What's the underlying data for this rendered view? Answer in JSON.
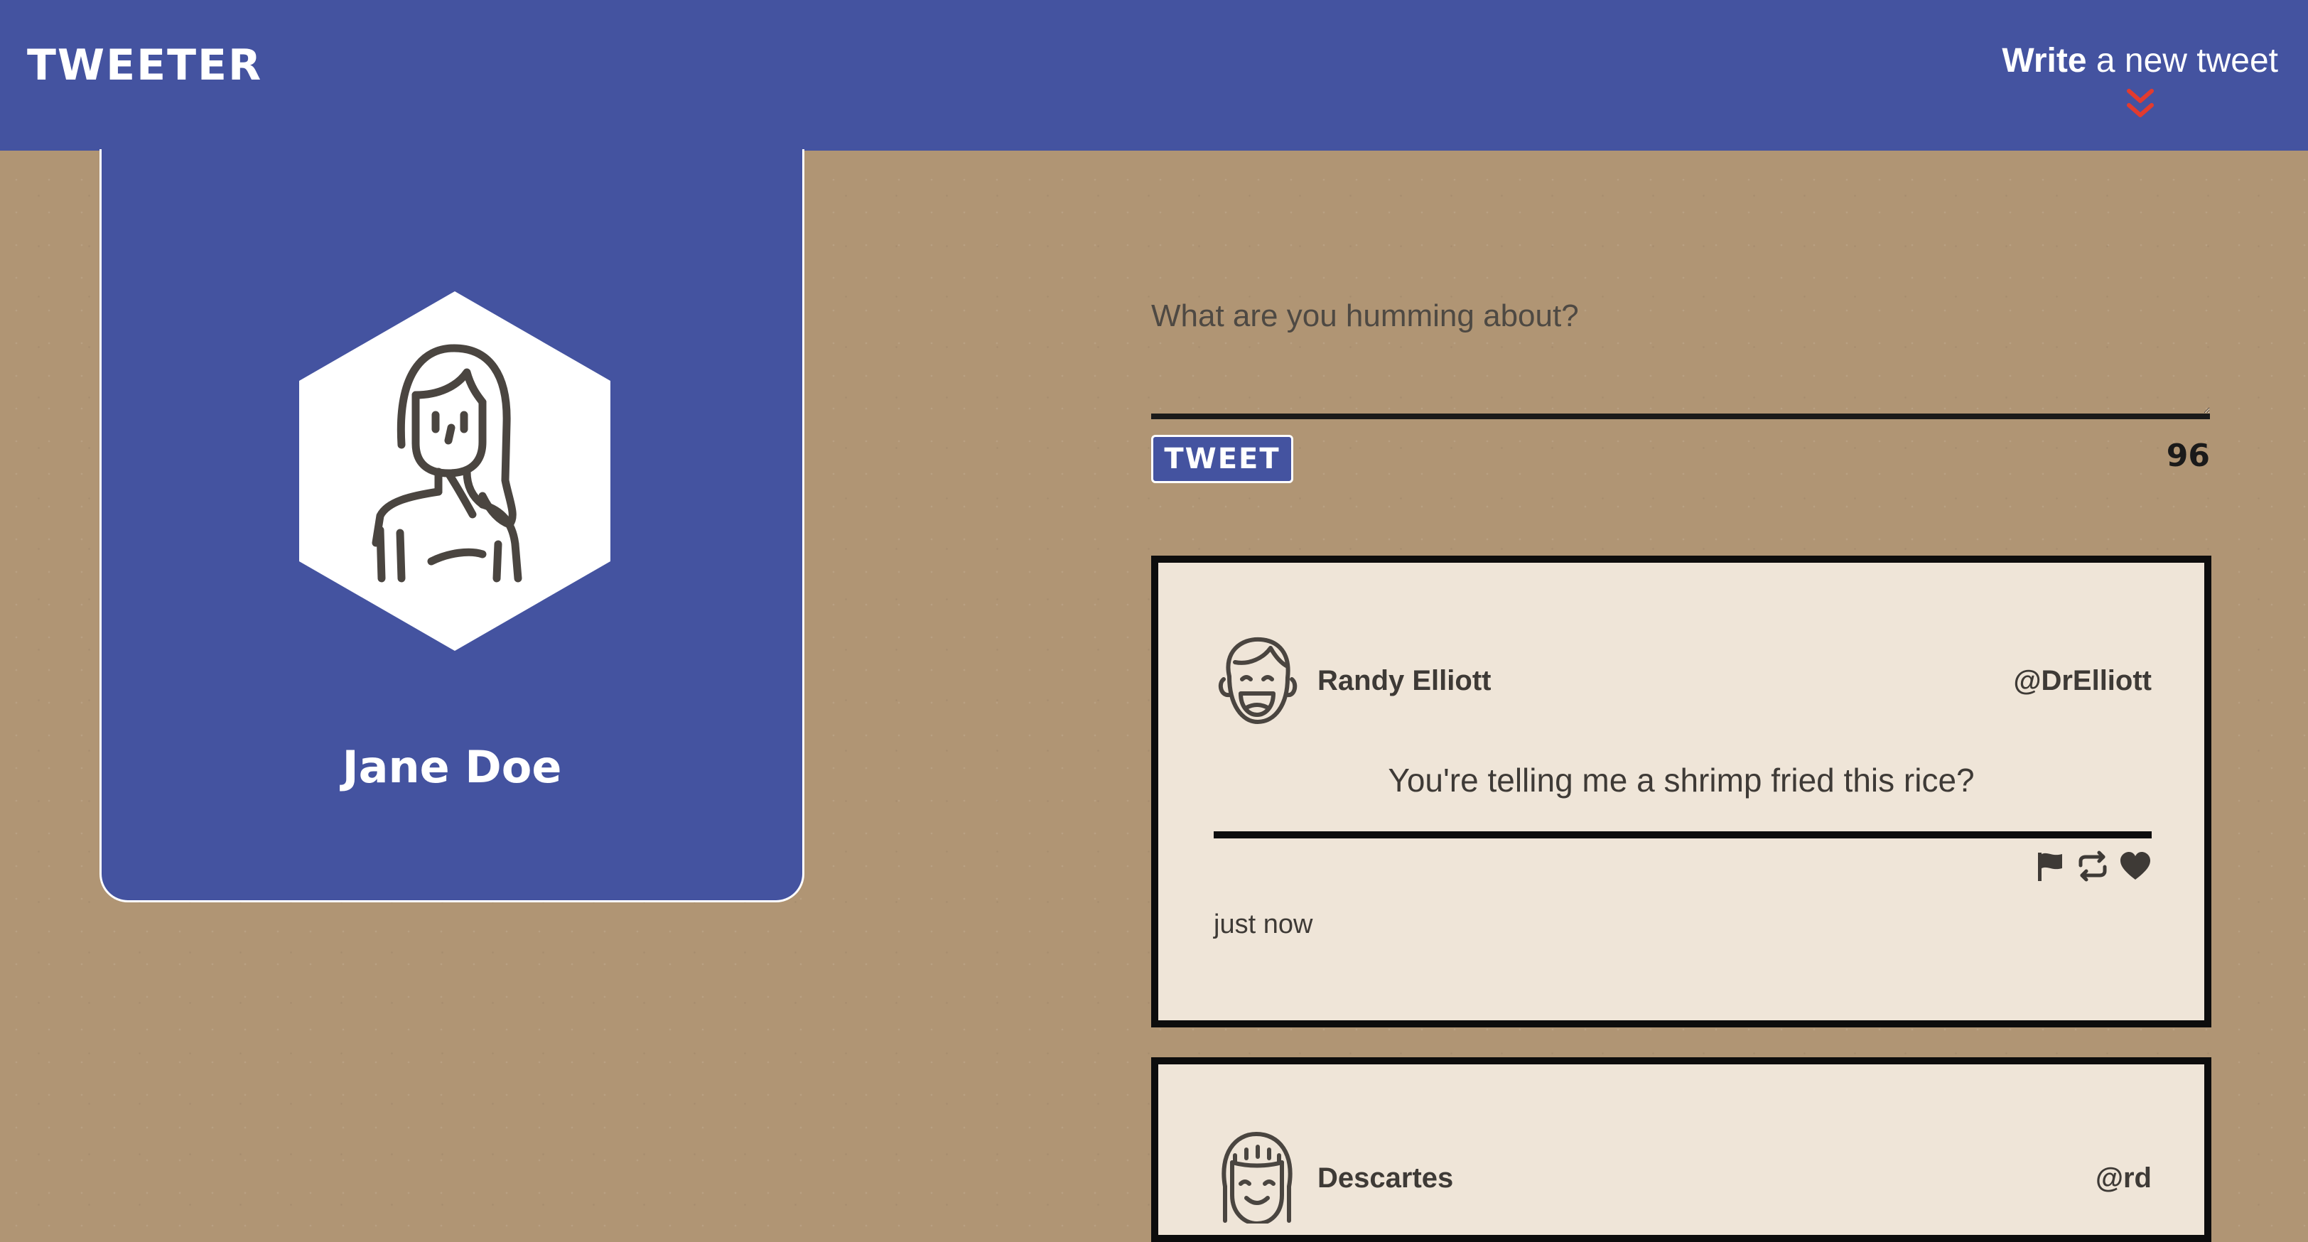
{
  "nav": {
    "logo": "TWEETER",
    "compose_bold": "Write",
    "compose_rest": " a new tweet",
    "arrow_icon": "double-chevron-down-icon",
    "background_color": "#4453a0",
    "arrow_color": "#e23b2e"
  },
  "profile": {
    "name": "Jane Doe",
    "avatar_icon": "woman-avatar-icon"
  },
  "composer": {
    "placeholder": "What are you humming about?",
    "value": "",
    "submit_label": "TWEET",
    "char_count": "96"
  },
  "tweets": [
    {
      "author": "Randy Elliott",
      "handle": "@DrElliott",
      "content": "You're telling me a shrimp fried this rice?",
      "time": "just now",
      "avatar_icon": "laughing-man-avatar-icon",
      "actions": [
        "flag-icon",
        "retweet-icon",
        "heart-icon"
      ]
    },
    {
      "author": "Descartes",
      "handle": "@rd",
      "content": "",
      "time": "",
      "avatar_icon": "smiling-avatar-icon",
      "actions": []
    }
  ],
  "colors": {
    "page_background": "#b09574",
    "card_background": "#efe5d8",
    "accent": "#4453a0",
    "border": "#0d0d0d"
  }
}
